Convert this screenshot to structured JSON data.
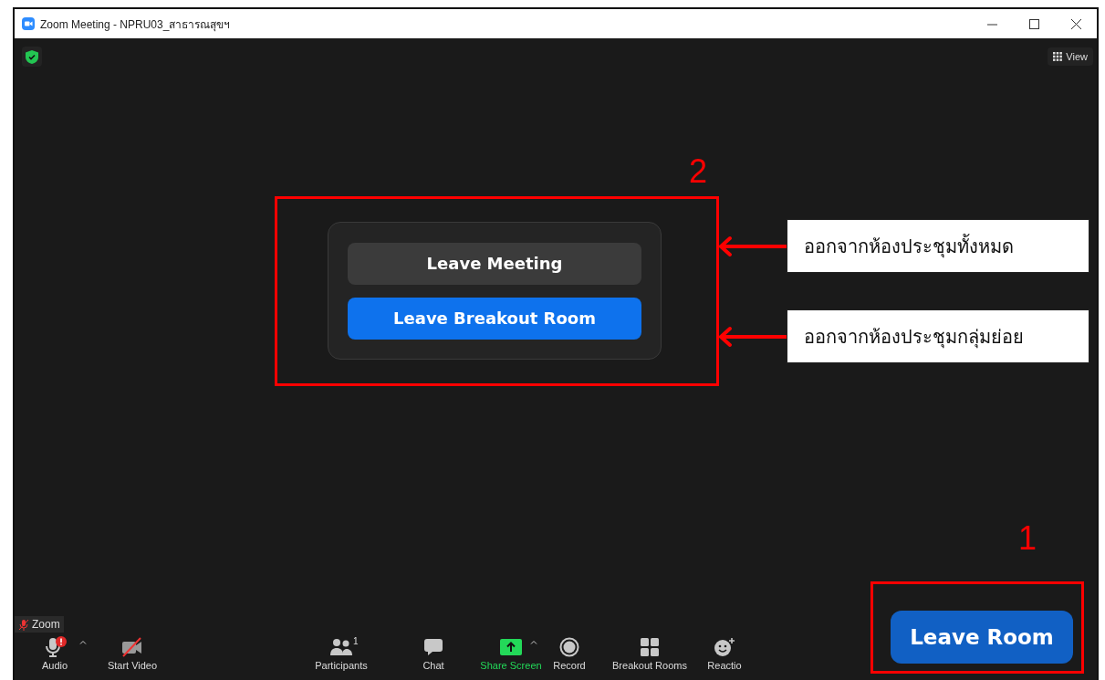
{
  "window": {
    "title": "Zoom Meeting - NPRU03_สาธารณสุขฯ"
  },
  "top_bar": {
    "view_label": "View"
  },
  "dialog": {
    "buttons": [
      {
        "label": "Leave Meeting",
        "kind": "secondary"
      },
      {
        "label": "Leave Breakout Room",
        "kind": "primary"
      }
    ]
  },
  "name_tag": {
    "label": "Zoom"
  },
  "toolbar": {
    "items": [
      {
        "kind": "audio",
        "label": "Audio",
        "caret": true,
        "alert": true
      },
      {
        "kind": "video",
        "label": "Start Video",
        "caret": false
      },
      {
        "kind": "participants",
        "label": "Participants",
        "count": "1",
        "caret": false
      },
      {
        "kind": "chat",
        "label": "Chat",
        "caret": false
      },
      {
        "kind": "share",
        "label": "Share Screen",
        "caret": true,
        "highlighted": true
      },
      {
        "kind": "record",
        "label": "Record",
        "caret": false
      },
      {
        "kind": "breakout",
        "label": "Breakout Rooms",
        "caret": false
      },
      {
        "kind": "reactions",
        "label": "Reactio",
        "caret": false
      }
    ]
  },
  "leave_room_button": {
    "label": "Leave Room"
  },
  "annotations": {
    "markers": [
      "2",
      "1"
    ],
    "callouts": [
      "ออกจากห้องประชุมทั้งหมด",
      "ออกจากห้องประชุมกลุ่มย่อย"
    ]
  }
}
